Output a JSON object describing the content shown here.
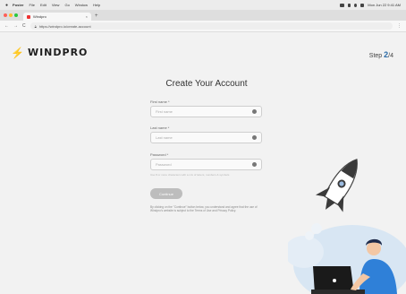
{
  "menubar": {
    "apple": "",
    "items": [
      "Poster",
      "File",
      "Edit",
      "View",
      "Go",
      "Window",
      "Help"
    ],
    "clock": "Mon Jun 22  9:41 AM"
  },
  "browser": {
    "tab_title": "Windpro",
    "tab_close": "×",
    "new_tab": "+",
    "url": "https://windpro.io/create-account",
    "nav_back": "←",
    "nav_forward": "→",
    "nav_reload": "C",
    "menu": "⋮"
  },
  "header": {
    "logo_symbol": "⚡",
    "logo_text": "WINDPRO",
    "step_prefix": "Step ",
    "step_current": "2",
    "step_total": "/4"
  },
  "form": {
    "title": "Create Your Account",
    "first_name_label": "First name *",
    "first_name_placeholder": "First name",
    "last_name_label": "Last name *",
    "last_name_placeholder": "Last name",
    "password_label": "Password *",
    "password_placeholder": "Password",
    "password_hint": "Use 8 or more characters with a mix of letters, numbers & symbols",
    "continue_label": "Continue",
    "terms_text": "By clicking on the \"Continue\" button below, you understand and agree that the use of Windpro's website is subject to the Terms of Use and Privacy Policy."
  },
  "colors": {
    "brand_red": "#e3312f",
    "step_blue": "#2a6aa6",
    "button_disabled": "#bdbdbd"
  },
  "icons": {
    "field_icon": "eye-icon",
    "illustration": "rocket-illustration"
  }
}
